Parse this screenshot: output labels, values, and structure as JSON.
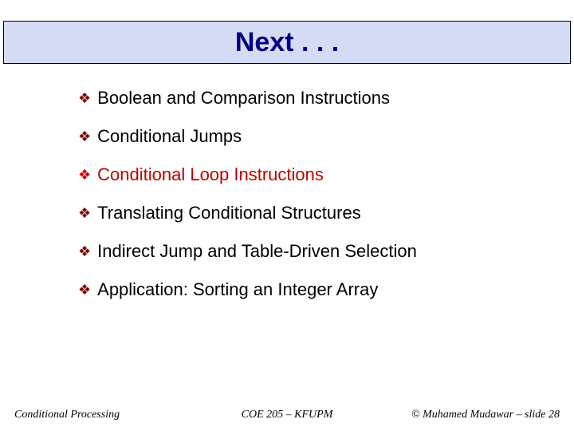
{
  "title": "Next . . .",
  "items": [
    {
      "text": "Boolean and Comparison Instructions",
      "current": false
    },
    {
      "text": "Conditional Jumps",
      "current": false
    },
    {
      "text": "Conditional Loop Instructions",
      "current": true
    },
    {
      "text": "Translating Conditional Structures",
      "current": false
    },
    {
      "text": "Indirect Jump and Table-Driven Selection",
      "current": false
    },
    {
      "text": "Application: Sorting an Integer Array",
      "current": false
    }
  ],
  "footer": {
    "left": "Conditional Processing",
    "center": "COE 205 – KFUPM",
    "right": "© Muhamed Mudawar – slide 28"
  }
}
